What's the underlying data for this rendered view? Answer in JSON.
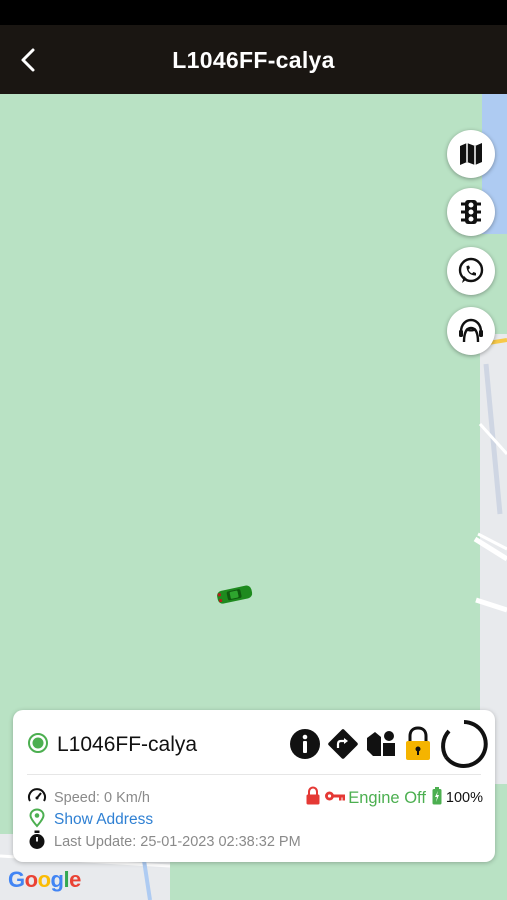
{
  "header": {
    "title": "L1046FF-calya"
  },
  "vehicle": {
    "name": "L1046FF-calya",
    "speed": "Speed: 0 Km/h",
    "address_link": "Show Address",
    "last_update": "Last Update: 25-01-2023 02:38:32 PM",
    "engine_status": "Engine Off",
    "battery": "100%"
  },
  "map_buttons": [
    "map-type-icon",
    "traffic-light-icon",
    "whatsapp-icon",
    "support-agent-icon"
  ],
  "actions": [
    "info-icon",
    "directions-icon",
    "shapes-icon",
    "lock-icon",
    "loading-ring-icon"
  ],
  "map": {
    "attribution": "Google"
  },
  "colors": {
    "header_bg": "#1a1612",
    "status_green": "#4caf50",
    "link_blue": "#2f80d3",
    "lock_red": "#e53935",
    "lock_yellow": "#f5b400"
  }
}
